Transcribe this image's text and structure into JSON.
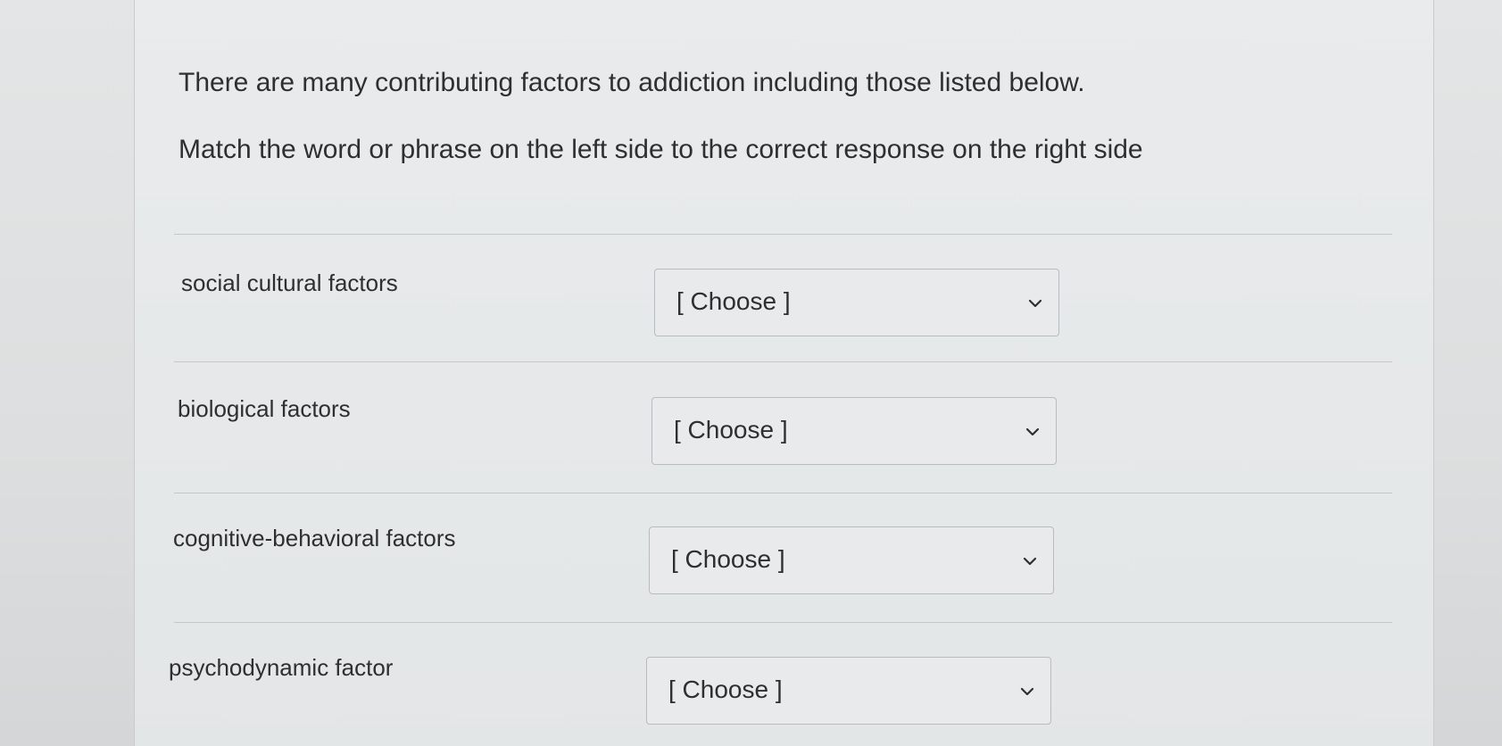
{
  "question": {
    "intro": "There are many contributing factors to addiction including those listed below.",
    "instruction": "Match the word or phrase on the left side to the correct response on the right side"
  },
  "matches": [
    {
      "label": "social cultural factors",
      "selected": "[ Choose ]"
    },
    {
      "label": "biological factors",
      "selected": "[ Choose ]"
    },
    {
      "label": "cognitive-behavioral factors",
      "selected": "[ Choose ]"
    },
    {
      "label": "psychodynamic factor",
      "selected": "[ Choose ]"
    }
  ],
  "icons": {
    "dropdown": "chevron-down-icon"
  },
  "colors": {
    "text": "#2d2f31",
    "border": "#b9bcbf",
    "background": "#e3e6e7"
  }
}
